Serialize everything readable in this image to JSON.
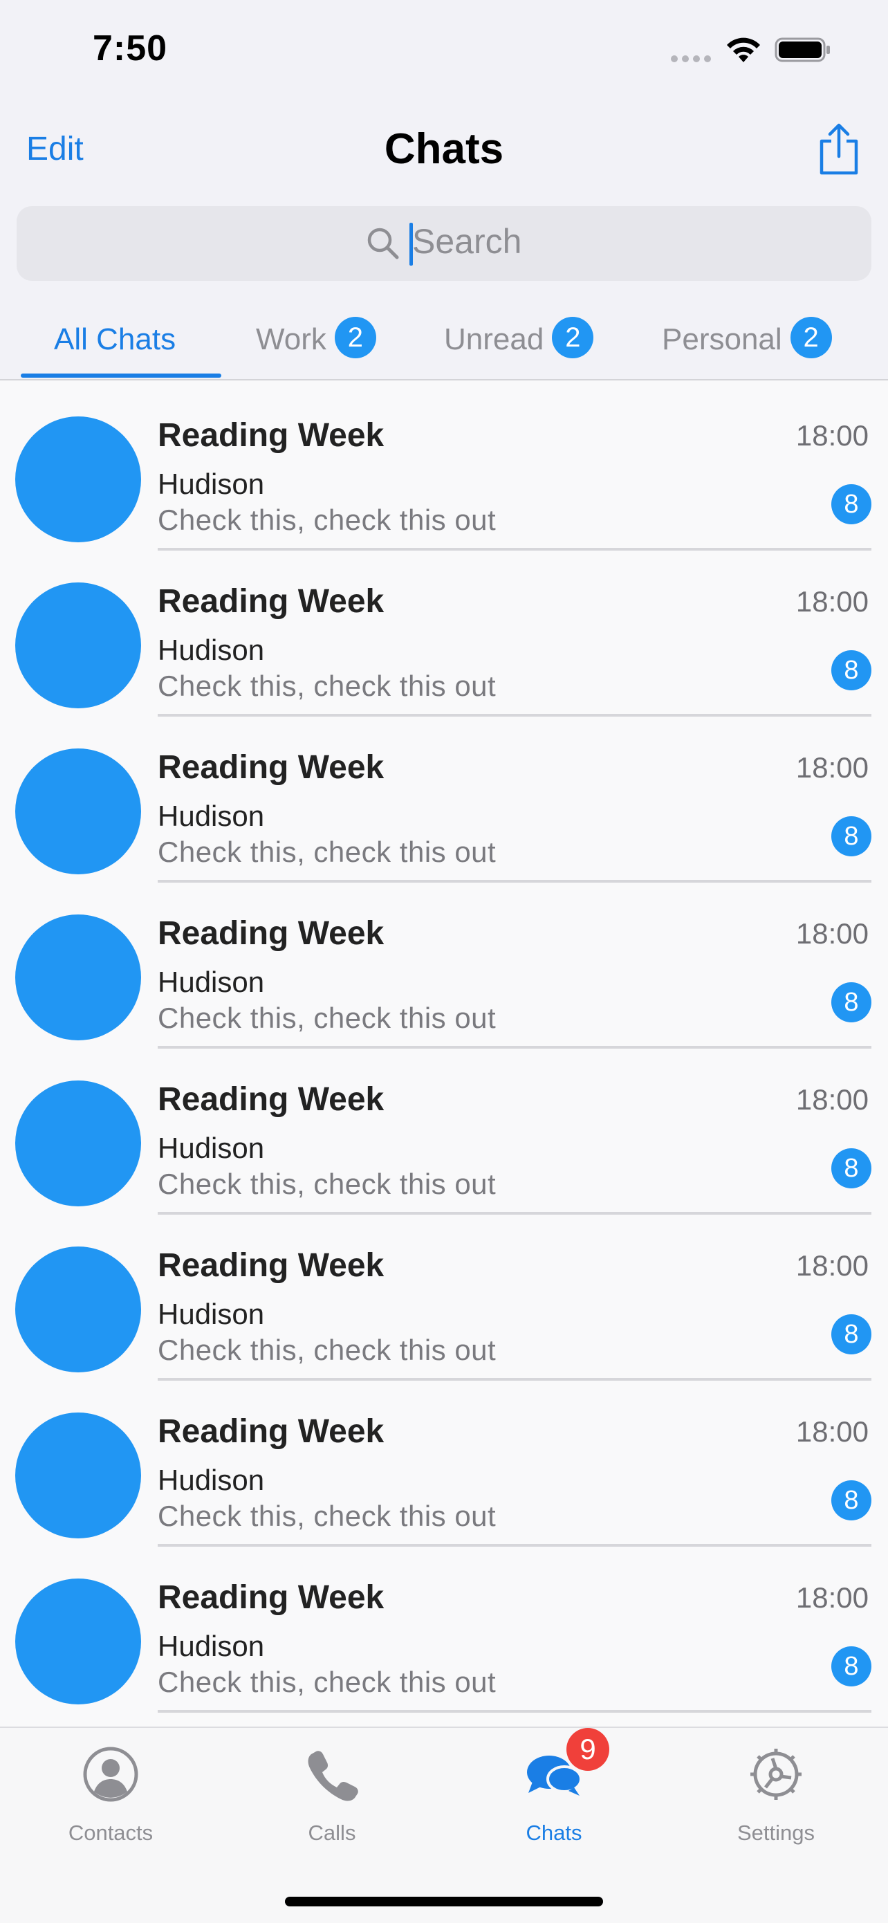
{
  "status_bar": {
    "time": "7:50"
  },
  "header": {
    "edit_label": "Edit",
    "title": "Chats",
    "share_icon": "share-icon"
  },
  "search": {
    "placeholder": "Search"
  },
  "tabs": [
    {
      "label": "All Chats",
      "badge": "",
      "active": true
    },
    {
      "label": "Work",
      "badge": "2",
      "active": false
    },
    {
      "label": "Unread",
      "badge": "2",
      "active": false
    },
    {
      "label": "Personal",
      "badge": "2",
      "active": false
    }
  ],
  "chats": [
    {
      "title": "Reading Week",
      "sender": "Hudison",
      "preview": "Check this, check this out",
      "time": "18:00",
      "unread": "8"
    },
    {
      "title": "Reading Week",
      "sender": "Hudison",
      "preview": "Check this, check this out",
      "time": "18:00",
      "unread": "8"
    },
    {
      "title": "Reading Week",
      "sender": "Hudison",
      "preview": "Check this, check this out",
      "time": "18:00",
      "unread": "8"
    },
    {
      "title": "Reading Week",
      "sender": "Hudison",
      "preview": "Check this, check this out",
      "time": "18:00",
      "unread": "8"
    },
    {
      "title": "Reading Week",
      "sender": "Hudison",
      "preview": "Check this, check this out",
      "time": "18:00",
      "unread": "8"
    },
    {
      "title": "Reading Week",
      "sender": "Hudison",
      "preview": "Check this, check this out",
      "time": "18:00",
      "unread": "8"
    },
    {
      "title": "Reading Week",
      "sender": "Hudison",
      "preview": "Check this, check this out",
      "time": "18:00",
      "unread": "8"
    },
    {
      "title": "Reading Week",
      "sender": "Hudison",
      "preview": "Check this, check this out",
      "time": "18:00",
      "unread": "8"
    }
  ],
  "tab_bar": {
    "items": [
      {
        "label": "Contacts",
        "icon": "person-circle-icon",
        "active": false
      },
      {
        "label": "Calls",
        "icon": "phone-icon",
        "active": false
      },
      {
        "label": "Chats",
        "icon": "chat-bubbles-icon",
        "active": true,
        "badge": "9"
      },
      {
        "label": "Settings",
        "icon": "gear-icon",
        "active": false
      }
    ]
  },
  "colors": {
    "accent": "#1a7ee5",
    "avatar": "#2196f3",
    "badge": "#2196f3",
    "notification_badge": "#f0403a"
  }
}
